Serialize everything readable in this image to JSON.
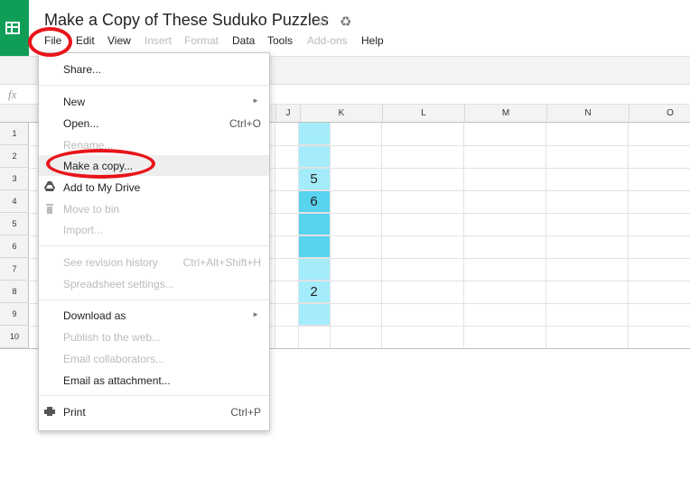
{
  "app": {
    "title": "Make a Copy of These Suduko Puzzles"
  },
  "menubar": {
    "items": [
      {
        "label": "File",
        "enabled": true
      },
      {
        "label": "Edit",
        "enabled": true
      },
      {
        "label": "View",
        "enabled": true
      },
      {
        "label": "Insert",
        "enabled": false
      },
      {
        "label": "Format",
        "enabled": false
      },
      {
        "label": "Data",
        "enabled": true
      },
      {
        "label": "Tools",
        "enabled": true
      },
      {
        "label": "Add-ons",
        "enabled": false
      },
      {
        "label": "Help",
        "enabled": true
      }
    ]
  },
  "formula_bar": {
    "fx_label": "fx"
  },
  "grid": {
    "columns": [
      "J",
      "K",
      "L",
      "M",
      "N",
      "O"
    ],
    "rows": [
      "1",
      "2",
      "3",
      "4",
      "5",
      "6",
      "7",
      "8",
      "9",
      "10"
    ],
    "cell_values": {
      "row3": "5",
      "row4": "6",
      "row8": "2"
    },
    "highlight_color": "#a4ecfb",
    "highlight_dark_color": "#58d3f0"
  },
  "file_menu": {
    "items": [
      {
        "label": "Share...",
        "enabled": true
      },
      {
        "label": "New",
        "enabled": true,
        "submenu": true
      },
      {
        "label": "Open...",
        "shortcut": "Ctrl+O",
        "enabled": true
      },
      {
        "label": "Rename...",
        "enabled": false
      },
      {
        "label": "Make a copy...",
        "enabled": true,
        "highlighted": true
      },
      {
        "label": "Add to My Drive",
        "enabled": true,
        "icon": "drive-icon"
      },
      {
        "label": "Move to bin",
        "enabled": false,
        "icon": "trash-icon"
      },
      {
        "label": "Import...",
        "enabled": false
      },
      {
        "label": "See revision history",
        "shortcut": "Ctrl+Alt+Shift+H",
        "enabled": false
      },
      {
        "label": "Spreadsheet settings...",
        "enabled": false
      },
      {
        "label": "Download as",
        "enabled": true,
        "submenu": true
      },
      {
        "label": "Publish to the web...",
        "enabled": false
      },
      {
        "label": "Email collaborators...",
        "enabled": false
      },
      {
        "label": "Email as attachment...",
        "enabled": true
      },
      {
        "label": "Print",
        "shortcut": "Ctrl+P",
        "enabled": true,
        "icon": "printer-icon"
      }
    ]
  },
  "annotation_color": "#e8141a",
  "brand_color": "#0f9d58"
}
